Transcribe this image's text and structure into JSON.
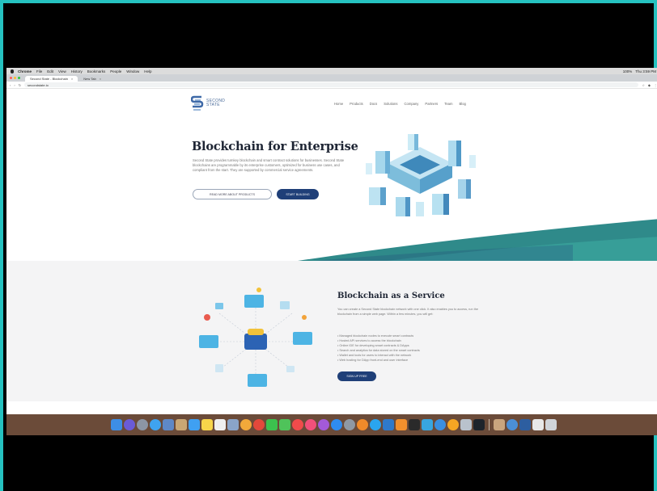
{
  "menubar": {
    "items": [
      "Chrome",
      "File",
      "Edit",
      "View",
      "History",
      "Bookmarks",
      "People",
      "Window",
      "Help"
    ],
    "status": [
      "100%",
      "Thu 3:59 PM"
    ]
  },
  "browser": {
    "tabs": [
      {
        "label": "Second State - Blockchain",
        "active": true
      },
      {
        "label": "New Tab",
        "active": false
      }
    ],
    "url": "secondstate.io"
  },
  "site": {
    "logo_line1": "SECOND",
    "logo_line2": "STATE",
    "nav": [
      "Home",
      "Products",
      "Docs",
      "Solutions",
      "Company",
      "Partners",
      "Team",
      "Blog"
    ],
    "hero": {
      "title": "Blockchain for Enterprise",
      "body": "Second State provides turnkey blockchain and smart contract solutions for businesses. Second State blockchains are programmable by its enterprise customers, optimized for business use cases, and compliant from the start. They are supported by commercial service agreements.",
      "btn_outline": "READ MORE ABOUT PRODUCTS",
      "btn_solid": "START BUILDING"
    },
    "section2": {
      "title": "Blockchain as a Service",
      "body": "You can create a Second State blockchain network with one click. It also enables you to access, run the blockchain from a simple web page. Within a few minutes, you will get:",
      "bullets": [
        "• Managed blockchain nodes to execute smart contracts",
        "• Hosted API services to access the blockchain",
        "• Online IDE for developing smart contracts & DApps",
        "• Search and analytics for data stored on the smart contracts",
        "• Wallet and tools for users to interact with the network",
        "• Web hosting for DApp front-end and user interface"
      ],
      "btn": "SIGN UP FREE"
    }
  },
  "colors": {
    "frame_border": "#25c2c0",
    "primary_button": "#1f3f78",
    "wave_teal": "#2f8a8a",
    "wave_navy": "#1f3f78",
    "dock_bg": "#6b4b39"
  },
  "dock_icons": [
    "finder-icon",
    "siri-icon",
    "launchpad-icon",
    "safari-icon",
    "photo-icon",
    "contacts-icon",
    "mail-icon",
    "notes-icon",
    "reminders-icon",
    "preview-icon",
    "photos-icon",
    "chrome-icon",
    "facetime-icon",
    "messages-icon",
    "news-icon",
    "music-icon",
    "podcasts-icon",
    "appstore-icon",
    "settings-icon",
    "firefox-icon",
    "skype-icon",
    "vscode-icon",
    "sublime-icon",
    "terminal-icon",
    "telegram-icon",
    "vpn-icon",
    "sketch-icon",
    "tools-icon",
    "screenshot-icon",
    "trash-icon"
  ]
}
